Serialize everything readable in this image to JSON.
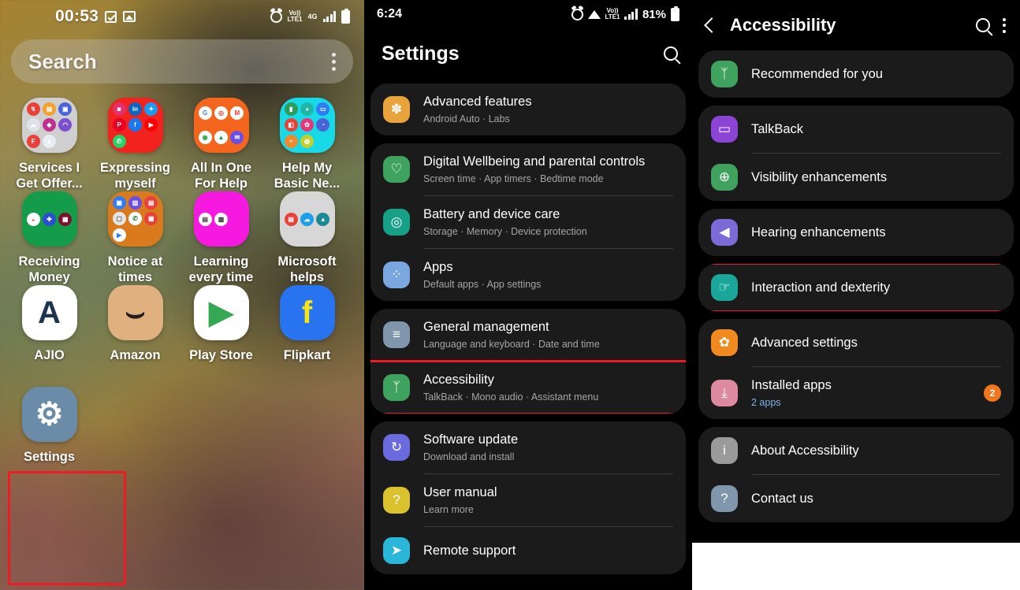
{
  "home": {
    "status": {
      "time": "00:53",
      "icons": [
        "checkbox-icon",
        "image-icon",
        "alarm-icon",
        "volte-icon",
        "network-4g",
        "signal-bars",
        "battery-icon"
      ],
      "volte_label": "Vo))",
      "volte_sub": "LTE1",
      "net": "4G"
    },
    "search": {
      "placeholder": "Search",
      "menu": "more-options"
    },
    "apps": [
      {
        "label": "Services I Get Offer...",
        "kind": "folder",
        "color": "#cfcfcf",
        "dots": [
          {
            "c": "#e8413a",
            "g": "↯"
          },
          {
            "c": "#f0a12e",
            "g": "▤"
          },
          {
            "c": "#4a63d8",
            "g": "▣"
          },
          {
            "c": "#dfe3e8",
            "g": "☁"
          },
          {
            "c": "#c0318f",
            "g": "◆"
          },
          {
            "c": "#7b4fd0",
            "g": "◠"
          },
          {
            "c": "#e8413a",
            "g": "F"
          },
          {
            "c": "#e9eef2",
            "g": "▲"
          }
        ]
      },
      {
        "label": "Expressing myself",
        "kind": "folder",
        "color": "#f2221f",
        "dots": [
          {
            "c": "#e1306c",
            "g": "◙"
          },
          {
            "c": "#0a66c2",
            "g": "in"
          },
          {
            "c": "#1d9bf0",
            "g": "✦"
          },
          {
            "c": "#e60023",
            "g": "P"
          },
          {
            "c": "#1877f2",
            "g": "f"
          },
          {
            "c": "#ff0000",
            "g": "▶"
          },
          {
            "c": "#25d366",
            "g": "✆"
          }
        ]
      },
      {
        "label": "All In One For Help",
        "kind": "folder",
        "color": "#f4661e",
        "dots": [
          {
            "c": "#ffffff",
            "g": "G",
            "t": "#4285f4"
          },
          {
            "c": "#ffffff",
            "g": "◎",
            "t": "#ea4335"
          },
          {
            "c": "#ffffff",
            "g": "M",
            "t": "#ea4335"
          },
          {
            "c": "#ffffff",
            "g": "◉",
            "t": "#34a853"
          },
          {
            "c": "#ffffff",
            "g": "▲",
            "t": "#0f9d58"
          },
          {
            "c": "#6b4ee6",
            "g": "✉"
          }
        ]
      },
      {
        "label": "Help My Basic Ne...",
        "kind": "folder",
        "color": "#18dae6",
        "dots": [
          {
            "c": "#2a9d5c",
            "g": "▮"
          },
          {
            "c": "#1fb6a8",
            "g": "◕"
          },
          {
            "c": "#2f7df6",
            "g": "▭"
          },
          {
            "c": "#e8413a",
            "g": "◧"
          },
          {
            "c": "#e8367a",
            "g": "✿"
          },
          {
            "c": "#4a63d8",
            "g": "◔"
          },
          {
            "c": "#f08a2e",
            "g": "◓"
          },
          {
            "c": "#c2cf2e",
            "g": "◍"
          }
        ]
      },
      {
        "label": "Receiving Money",
        "kind": "folder",
        "color": "#149c4a",
        "dots": [
          {
            "c": "#ffffff",
            "g": "◒",
            "t": "#e8413a"
          },
          {
            "c": "#2a4fd0",
            "g": "✚"
          },
          {
            "c": "#7b1030",
            "g": "▦"
          }
        ]
      },
      {
        "label": "Notice at times",
        "kind": "folder",
        "color": "#d97a1e",
        "dots": [
          {
            "c": "#2f7df6",
            "g": "▣"
          },
          {
            "c": "#6b4ee6",
            "g": "▥"
          },
          {
            "c": "#e8413a",
            "g": "▤"
          },
          {
            "c": "#e6e6e6",
            "g": "▢",
            "t": "#555"
          },
          {
            "c": "#ffffff",
            "g": "✆",
            "t": "#1b7a3a"
          },
          {
            "c": "#e8413a",
            "g": "▦"
          },
          {
            "c": "#ffffff",
            "g": "▶",
            "t": "#2f7df6"
          }
        ]
      },
      {
        "label": "Learning every time",
        "kind": "folder",
        "color": "#f619e0",
        "dots": [
          {
            "c": "#ffffff",
            "g": "▤",
            "t": "#444"
          },
          {
            "c": "#ffffff",
            "g": "▩",
            "t": "#444"
          }
        ]
      },
      {
        "label": "Microsoft helps",
        "kind": "folder",
        "color": "#d7d7d7",
        "dots": [
          {
            "c": "#e8413a",
            "g": "▤"
          },
          {
            "c": "#1b9fe8",
            "g": "☁"
          },
          {
            "c": "#1b8a92",
            "g": "▲"
          }
        ]
      },
      {
        "label": "AJIO",
        "kind": "app",
        "color": "#ffffff",
        "glyph": "A",
        "glyph_color": "#1b3550"
      },
      {
        "label": "Amazon",
        "kind": "app",
        "color": "#e0b07e",
        "glyph": "⌣",
        "glyph_color": "#231f20"
      },
      {
        "label": "Play Store",
        "kind": "app",
        "color": "#ffffff",
        "glyph": "▶",
        "glyph_color": "#34a853"
      },
      {
        "label": "Flipkart",
        "kind": "app",
        "color": "#2874f0",
        "glyph": "f",
        "glyph_color": "#f7e316"
      },
      {
        "label": "Settings",
        "kind": "app",
        "color": "#6b8ca8",
        "glyph": "⚙",
        "glyph_color": "#ffffff",
        "highlighted": true
      }
    ],
    "highlight_color": "#ee1b24"
  },
  "settings": {
    "status": {
      "time": "6:24",
      "battery": "81%"
    },
    "title": "Settings",
    "search_icon": "search-icon",
    "groups": [
      {
        "items": [
          {
            "title": "Advanced features",
            "sub": "Android Auto  ·  Labs",
            "icon": "flower-icon",
            "color": "#e8a33d"
          }
        ]
      },
      {
        "items": [
          {
            "title": "Digital Wellbeing and parental controls",
            "sub": "Screen time  ·  App timers  ·  Bedtime mode",
            "icon": "wellbeing-icon",
            "color": "#3fa35f"
          },
          {
            "title": "Battery and device care",
            "sub": "Storage  ·  Memory  ·  Device protection",
            "icon": "battery-care-icon",
            "color": "#16a085"
          },
          {
            "title": "Apps",
            "sub": "Default apps  ·  App settings",
            "icon": "apps-grid-icon",
            "color": "#7ba7e0"
          }
        ]
      },
      {
        "items": [
          {
            "title": "General management",
            "sub": "Language and keyboard  ·  Date and time",
            "icon": "sliders-icon",
            "color": "#7f96ad"
          },
          {
            "title": "Accessibility",
            "sub": "TalkBack  ·  Mono audio  ·  Assistant menu",
            "icon": "accessibility-icon",
            "color": "#3fa35f",
            "highlighted": true
          }
        ]
      },
      {
        "items": [
          {
            "title": "Software update",
            "sub": "Download and install",
            "icon": "refresh-icon",
            "color": "#6b6be0"
          },
          {
            "title": "User manual",
            "sub": "Learn more",
            "icon": "manual-icon",
            "color": "#d9c22e"
          },
          {
            "title": "Remote support",
            "sub": "",
            "icon": "remote-support-icon",
            "color": "#2ab6d9"
          }
        ]
      }
    ]
  },
  "accessibility": {
    "back_icon": "back-arrow-icon",
    "title": "Accessibility",
    "search_icon": "search-icon",
    "menu_icon": "more-options-icon",
    "groups": [
      {
        "items": [
          {
            "title": "Recommended for you",
            "icon": "recommended-icon",
            "color": "#3fa35f"
          }
        ]
      },
      {
        "items": [
          {
            "title": "TalkBack",
            "icon": "talkback-icon",
            "color": "#8b44d4"
          },
          {
            "title": "Visibility enhancements",
            "icon": "magnifier-plus-icon",
            "color": "#3fa35f"
          }
        ]
      },
      {
        "items": [
          {
            "title": "Hearing enhancements",
            "icon": "speaker-icon",
            "color": "#7b6bd6"
          }
        ]
      },
      {
        "items": [
          {
            "title": "Interaction and dexterity",
            "icon": "tap-hand-icon",
            "color": "#1aa79a",
            "highlighted": true
          }
        ]
      },
      {
        "items": [
          {
            "title": "Advanced settings",
            "icon": "gear-plus-icon",
            "color": "#f08a1e"
          },
          {
            "title": "Installed apps",
            "sub": "2 apps",
            "icon": "download-icon",
            "color": "#dd8aa0",
            "badge": "2"
          }
        ]
      },
      {
        "items": [
          {
            "title": "About Accessibility",
            "icon": "info-icon",
            "color": "#9a9a9a"
          },
          {
            "title": "Contact us",
            "icon": "question-icon",
            "color": "#7f96ad"
          }
        ]
      }
    ]
  }
}
